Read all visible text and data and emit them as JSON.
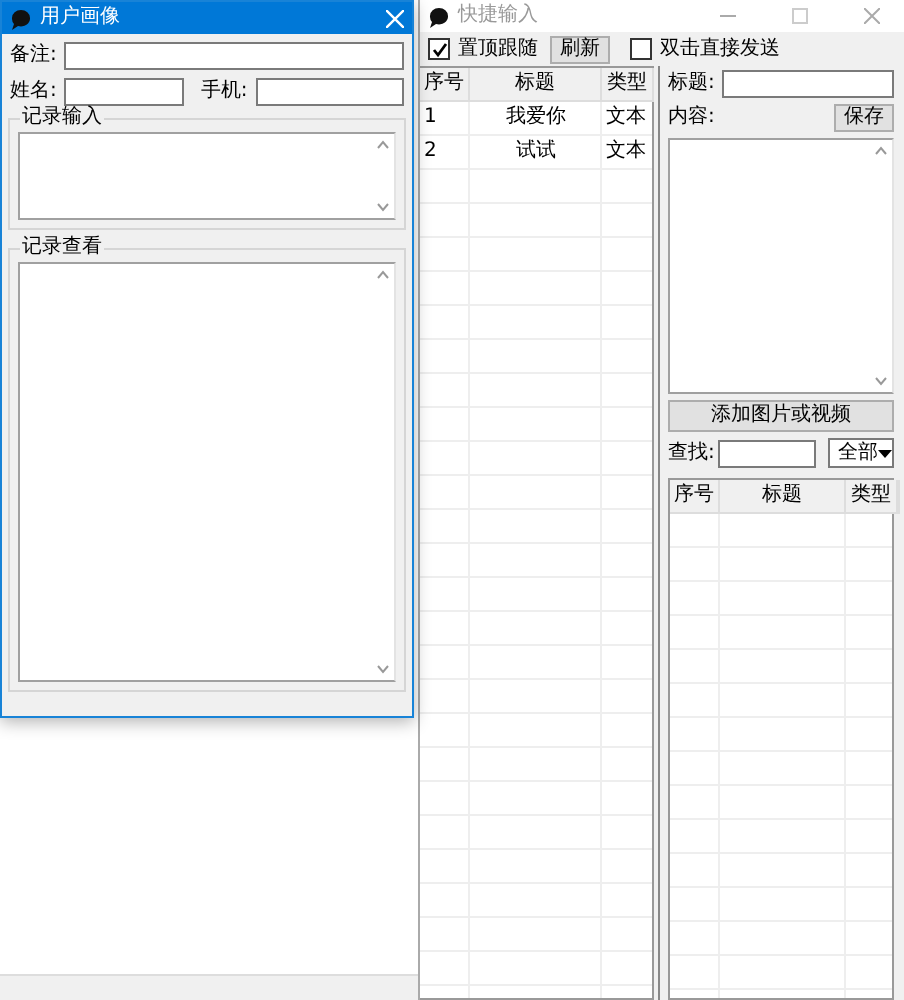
{
  "left_window": {
    "title": "用户画像",
    "fields": [
      {
        "label": "备注:"
      },
      {
        "label": "姓名:"
      },
      {
        "label": "手机:"
      }
    ],
    "groups": [
      {
        "title": "记录输入"
      },
      {
        "title": "记录查看"
      }
    ]
  },
  "right_window": {
    "title": "快捷输入",
    "toolbar": [
      {
        "kind": "checkbox",
        "label": "置顶跟随",
        "checked": true
      },
      {
        "kind": "button",
        "label": "刷新"
      },
      {
        "kind": "checkbox",
        "label": "双击直接发送",
        "checked": false
      }
    ],
    "list": {
      "columns": [
        "序号",
        "标题",
        "类型"
      ],
      "rows": [
        [
          "1",
          "我爱你",
          "文本"
        ],
        [
          "2",
          "试试",
          "文本"
        ]
      ]
    },
    "editor": {
      "title_label": "标题:",
      "content_label": "内容:",
      "save_button": "保存",
      "add_button": "添加图片或视频",
      "search_label": "查找:",
      "filter": "全部",
      "columns": [
        "序号",
        "标题",
        "类型"
      ]
    }
  }
}
